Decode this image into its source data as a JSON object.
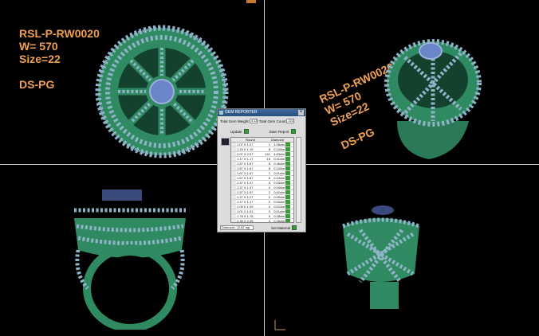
{
  "viewport_labels": {
    "top_left": "RSL-P-RW0020\nW= 570\nSize=22\n\nDS-PG",
    "top_right": "RSL-P-RW0020\nW= 570\nSize=22\n\nDS-PG"
  },
  "colors": {
    "metal": "#2f8a62",
    "gems": "#8fb4c8",
    "center_stone": "#6a86c8",
    "label": "#f0a050",
    "viewport_divider": "#d8d8d8"
  },
  "gem_reporter": {
    "title": "GEM REPORTER",
    "total_weight_label": "Total Gem Weight",
    "total_weight_value": "4.12",
    "total_count_label": "Total Gem Count",
    "total_count_value": "221",
    "update_label": "Update",
    "save_report_label": "Save Report",
    "columns": [
      "Round",
      "Diamond"
    ],
    "rows": [
      {
        "size": "1.07 X 1.07",
        "count": "1",
        "weight": "1.08ctw"
      },
      {
        "size": "1.15 X 1.15",
        "count": "8",
        "weight": "0.14ctw"
      },
      {
        "size": "2.07 X 2.07",
        "count": "141",
        "weight": "4.83ctw"
      },
      {
        "size": "1.17 X 1.17",
        "count": "16",
        "weight": "0.41ctw"
      },
      {
        "size": "1.67 X 1.67",
        "count": "8",
        "weight": "0.48ctw"
      },
      {
        "size": "1.67 X 1.67",
        "count": "8",
        "weight": "0.14ctw"
      },
      {
        "size": "1.67 X 1.67",
        "count": "1",
        "weight": "0.01ctw"
      },
      {
        "size": "1.67 X 1.67",
        "count": "8",
        "weight": "0.14ctw"
      },
      {
        "size": "1.47 X 1.47",
        "count": "4",
        "weight": "0.03ctw"
      },
      {
        "size": "1.37 X 1.37",
        "count": "4",
        "weight": "0.04ctw"
      },
      {
        "size": "1.57 X 1.57",
        "count": "2",
        "weight": "0.02ctw"
      },
      {
        "size": "1.27 X 1.27",
        "count": "2",
        "weight": "0.09ctw"
      },
      {
        "size": "1.17 X 1.17",
        "count": "2",
        "weight": "0.00ctw"
      },
      {
        "size": "1.09 X 1.09",
        "count": "4",
        "weight": "0.01ctw"
      },
      {
        "size": "1.01 X 1.01",
        "count": "4",
        "weight": "0.01ctw"
      },
      {
        "size": "1.78 X 1.78",
        "count": "5",
        "weight": "0.18ctw"
      },
      {
        "size": "2.35 X 2.35",
        "count": "4",
        "weight": "0.16ctw"
      },
      {
        "size": "2.25 X 2.25",
        "count": "8",
        "weight": "0.17ctw"
      }
    ],
    "material_select": "Diamond : (3.52 sg)",
    "set_material_label": "Set Material"
  }
}
